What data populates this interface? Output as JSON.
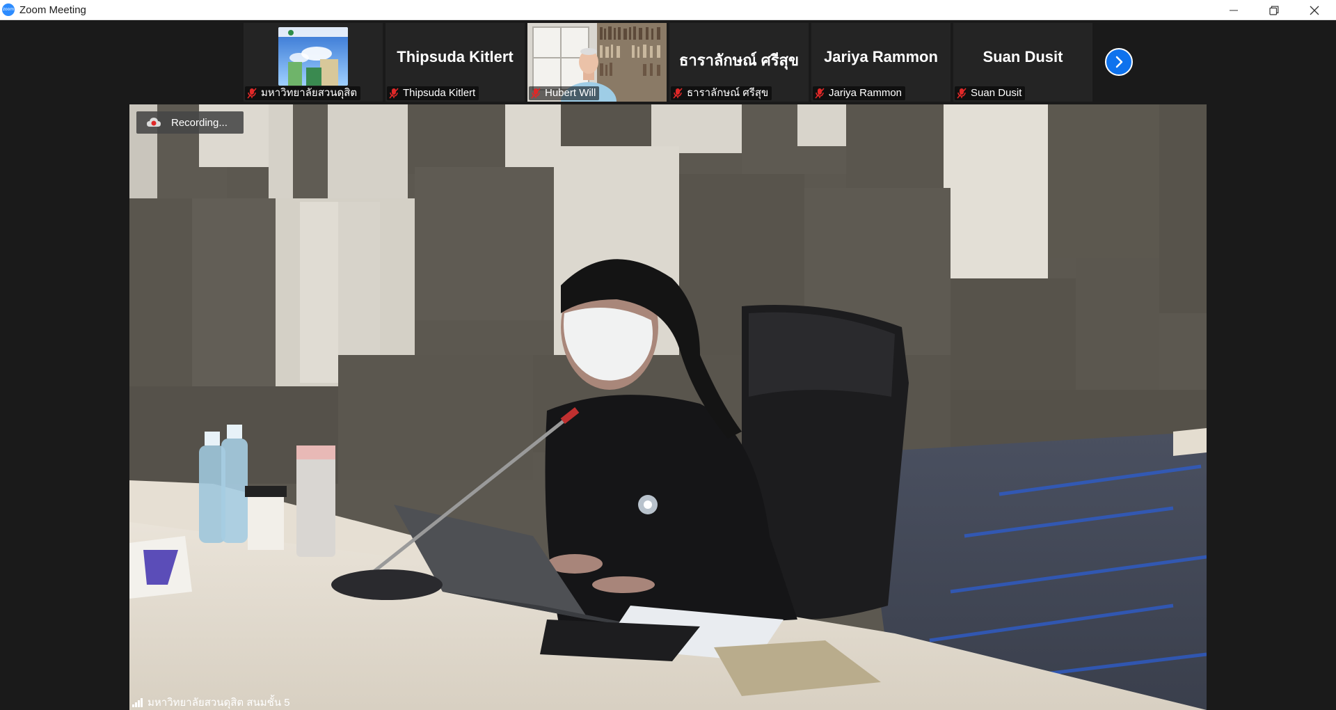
{
  "window": {
    "title": "Zoom Meeting",
    "logo_text": "zoom",
    "controls": [
      "minimize-icon",
      "restore-icon",
      "close-icon"
    ]
  },
  "gallery": {
    "participants": [
      {
        "display_name": "",
        "label": "มหาวิทยาลัยสวนดุสิต",
        "has_video": true,
        "muted": true
      },
      {
        "display_name": "Thipsuda Kitlert",
        "label": "Thipsuda Kitlert",
        "has_video": false,
        "muted": true
      },
      {
        "display_name": "",
        "label": "Hubert Will",
        "has_video": true,
        "muted": true
      },
      {
        "display_name": "ธาราลักษณ์ ศรีสุข",
        "label": "ธาราลักษณ์ ศรีสุข",
        "has_video": false,
        "muted": true
      },
      {
        "display_name": "Jariya Rammon",
        "label": "Jariya Rammon",
        "has_video": false,
        "muted": true
      },
      {
        "display_name": "Suan Dusit",
        "label": "Suan Dusit",
        "has_video": false,
        "muted": true
      }
    ],
    "next_page_icon": "chevron-right-icon"
  },
  "main_video": {
    "recording_label": "Recording...",
    "speaker_label": "มหาวิทยาลัยสวนดุสิต สนมชั้น 5"
  },
  "colors": {
    "accent": "#0e72ed",
    "mute_red": "#e02828",
    "strip_bg": "#1a1a1a",
    "tile_bg": "#242424"
  }
}
